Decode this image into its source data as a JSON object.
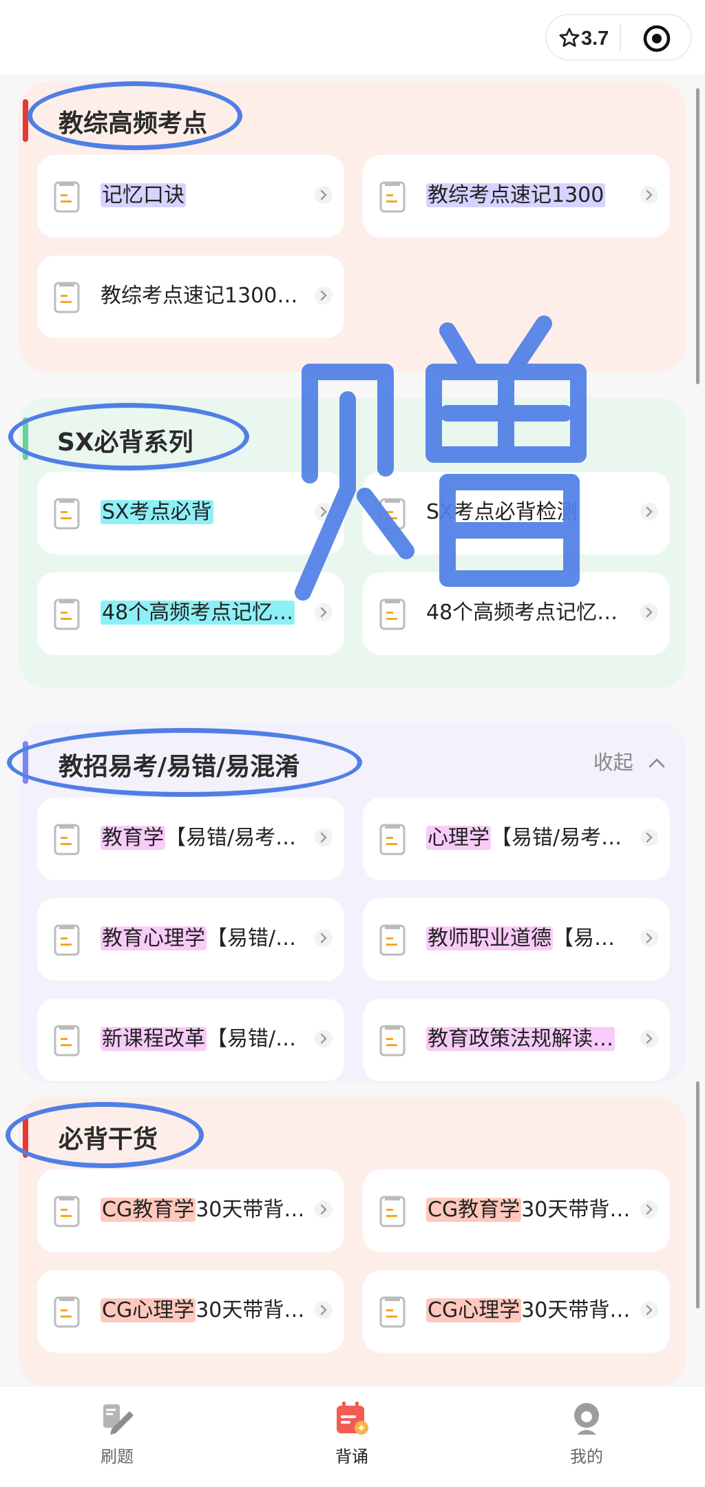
{
  "capsule": {
    "rating": "3.7",
    "icons": [
      "star-outline-icon",
      "target-icon"
    ]
  },
  "sections": [
    {
      "title": "教综高频考点",
      "accent_color": "#e53935",
      "background": "#fdeeea",
      "items": [
        {
          "label": "记忆口诀",
          "highlight": "#d6d3ff"
        },
        {
          "label": "教综考点速记1300",
          "highlight": "#d6d3ff"
        },
        {
          "label": "教综考点速记1300…",
          "highlight": ""
        }
      ]
    },
    {
      "title": "SX必背系列",
      "accent_color": "#66d39a",
      "background": "#e9f7ef",
      "items": [
        {
          "label": "SX考点必背",
          "highlight": "#8df0f6"
        },
        {
          "label": "SX考点必背检测",
          "highlight": ""
        },
        {
          "label": "48个高频考点记忆…",
          "highlight": "#8df0f6"
        },
        {
          "label": "48个高频考点记忆…",
          "highlight": ""
        }
      ]
    },
    {
      "title": "教招易考/易错/易混淆",
      "collapse_label": "收起",
      "accent_color": "#7c83f2",
      "background": "#f2f1fc",
      "items": [
        {
          "label": "【易错/易考…",
          "prefix": "教育学",
          "highlight": "#f8ccf8"
        },
        {
          "label": "【易错/易考…",
          "prefix": "心理学",
          "highlight": "#f8ccf8"
        },
        {
          "label": "【易错/…",
          "prefix": "教育心理学",
          "highlight": "#f8ccf8"
        },
        {
          "label": "【易…",
          "prefix": "教师职业道德",
          "highlight": "#f8ccf8"
        },
        {
          "label": "【易错/…",
          "prefix": "新课程改革",
          "highlight": "#f8ccf8"
        },
        {
          "label": "教育政策法规解读…",
          "prefix": "",
          "highlight": "#f8ccf8"
        }
      ]
    },
    {
      "title": "必背干货",
      "accent_color": "#e53935",
      "background": "#fdeeea",
      "items": [
        {
          "label": "30天带背…",
          "prefix": "CG教育学",
          "highlight": "#ffc8bc"
        },
        {
          "label": "30天带背…",
          "prefix": "CG教育学",
          "highlight": "#ffc8bc"
        },
        {
          "label": "30天带背…",
          "prefix": "CG心理学",
          "highlight": "#ffc8bc"
        },
        {
          "label": "30天带背…",
          "prefix": "CG心理学",
          "highlight": "#ffc8bc"
        }
      ]
    }
  ],
  "watermark": {
    "text": "赠",
    "color": "#4f7fe6"
  },
  "bottom_nav": [
    {
      "label": "刷题",
      "icon": "pencil-icon",
      "active": false
    },
    {
      "label": "背诵",
      "icon": "calendar-icon",
      "active": true
    },
    {
      "label": "我的",
      "icon": "profile-icon",
      "active": false
    }
  ],
  "colors": {
    "doc_icon_orange": "#f5a623",
    "ellipse_blue": "#4f7fe6",
    "active_nav": "#f25c54"
  }
}
